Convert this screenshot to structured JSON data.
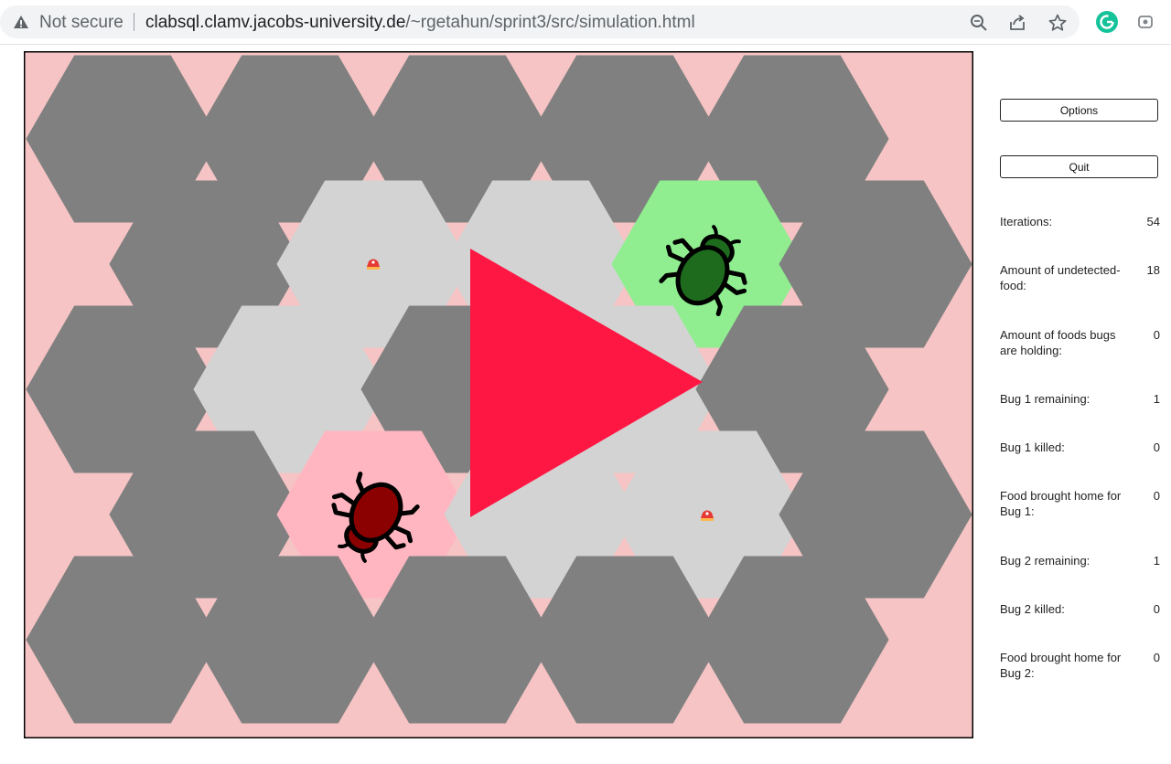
{
  "browser": {
    "security_label": "Not secure",
    "url_host": "clabsql.clamv.jacobs-university.de",
    "url_path": "/~rgetahun/sprint3/src/simulation.html",
    "extension_badge": "G"
  },
  "colors": {
    "background": "#f6c4c4",
    "rock": "#808080",
    "empty_cell": "#d3d3d3",
    "bug1_home": "#90ee90",
    "bug2_home": "#ffb6c1",
    "triangle": "#ff1744",
    "bug1": "#1e6b1e",
    "bug2": "#8b0000"
  },
  "icons": [
    "warning-icon",
    "zoom-icon",
    "share-icon",
    "star-icon",
    "grammarly-icon",
    "extension-icon",
    "bug-icon",
    "food-icon"
  ],
  "controls": {
    "options_label": "Options",
    "quit_label": "Quit"
  },
  "stats": [
    {
      "label": "Iterations:",
      "value": "54"
    },
    {
      "label": "Amount of undetected-food:",
      "value": "18"
    },
    {
      "label": "Amount of foods bugs are holding:",
      "value": "0"
    },
    {
      "label": "Bug 1 remaining:",
      "value": "1"
    },
    {
      "label": "Bug 1 killed:",
      "value": "0"
    },
    {
      "label": "Food brought home for Bug 1:",
      "value": "0"
    },
    {
      "label": "Bug 2 remaining:",
      "value": "1"
    },
    {
      "label": "Bug 2 killed:",
      "value": "0"
    },
    {
      "label": "Food brought home for Bug 2:",
      "value": "0"
    }
  ]
}
